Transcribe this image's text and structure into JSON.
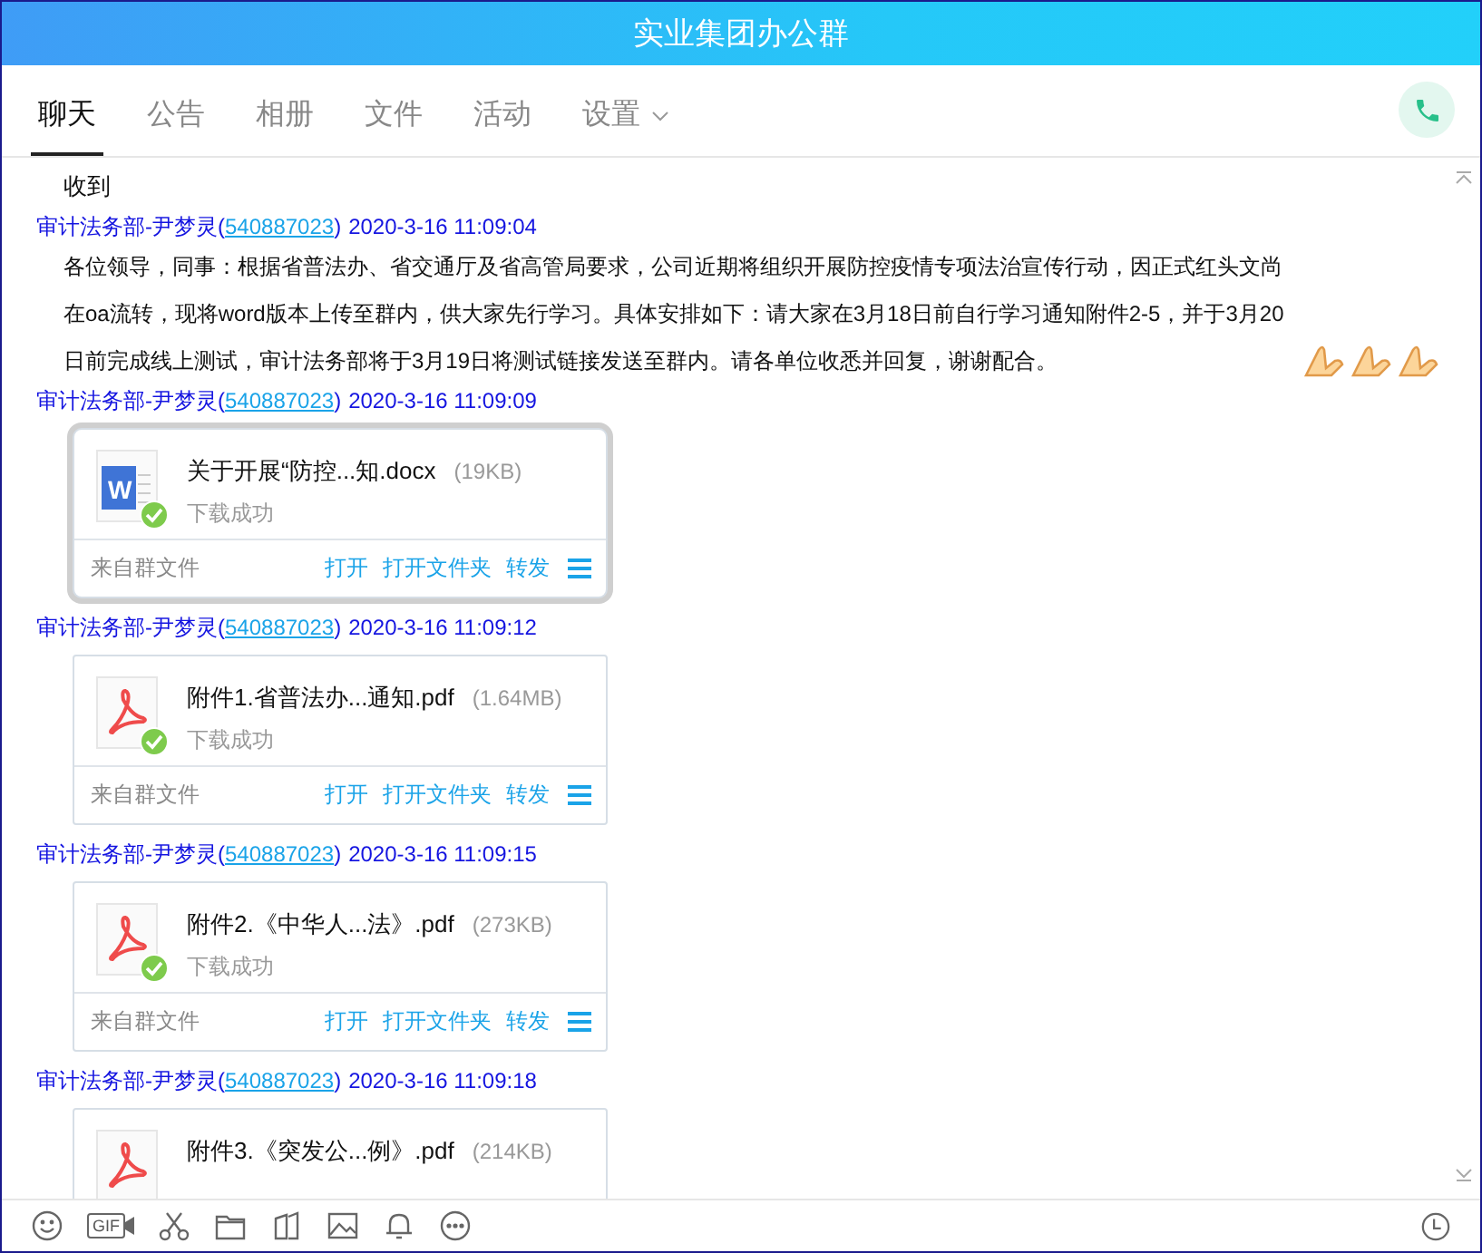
{
  "window": {
    "title": "实业集团办公群"
  },
  "tabs": [
    {
      "label": "聊天",
      "selected": true,
      "dropdown": false
    },
    {
      "label": "公告",
      "selected": false,
      "dropdown": false
    },
    {
      "label": "相册",
      "selected": false,
      "dropdown": false
    },
    {
      "label": "文件",
      "selected": false,
      "dropdown": false
    },
    {
      "label": "活动",
      "selected": false,
      "dropdown": false
    },
    {
      "label": "设置",
      "selected": false,
      "dropdown": true
    }
  ],
  "messages": [
    {
      "kind": "text",
      "body": "收到"
    },
    {
      "kind": "text",
      "sender_prefix": "审计法务部-尹梦灵(",
      "sender_id": "540887023",
      "sender_suffix": ")",
      "time": "2020-3-16 11:09:04",
      "body": "各位领导，同事：根据省普法办、省交通厅及省高管局要求，公司近期将组织开展防控疫情专项法治宣传行动，因正式红头文尚在oa流转，现将word版本上传至群内，供大家先行学习。具体安排如下：请大家在3月18日前自行学习通知附件2-5，并于3月20日前完成线上测试，审计法务部将于3月19日将测试链接发送至群内。请各单位收悉并回复，谢谢配合。",
      "emojis": [
        {
          "kind": "pray"
        },
        {
          "kind": "pray"
        },
        {
          "kind": "pray"
        }
      ]
    },
    {
      "kind": "file",
      "sender_prefix": "审计法务部-尹梦灵(",
      "sender_id": "540887023",
      "sender_suffix": ")",
      "time": "2020-3-16 11:09:09",
      "file": {
        "kind": "word",
        "icon_letter": "W",
        "name": "关于开展“防控...知.docx",
        "size": "(19KB)",
        "status": "下载成功",
        "selected": true,
        "source": "来自群文件",
        "actions": [
          "打开",
          "打开文件夹",
          "转发"
        ]
      }
    },
    {
      "kind": "file",
      "sender_prefix": "审计法务部-尹梦灵(",
      "sender_id": "540887023",
      "sender_suffix": ")",
      "time": "2020-3-16 11:09:12",
      "file": {
        "kind": "pdf",
        "name": "附件1.省普法办...通知.pdf",
        "size": "(1.64MB)",
        "status": "下载成功",
        "selected": false,
        "source": "来自群文件",
        "actions": [
          "打开",
          "打开文件夹",
          "转发"
        ]
      }
    },
    {
      "kind": "file",
      "sender_prefix": "审计法务部-尹梦灵(",
      "sender_id": "540887023",
      "sender_suffix": ")",
      "time": "2020-3-16 11:09:15",
      "file": {
        "kind": "pdf",
        "name": "附件2.《中华人...法》.pdf",
        "size": "(273KB)",
        "status": "下载成功",
        "selected": false,
        "source": "来自群文件",
        "actions": [
          "打开",
          "打开文件夹",
          "转发"
        ]
      }
    },
    {
      "kind": "file",
      "sender_prefix": "审计法务部-尹梦灵(",
      "sender_id": "540887023",
      "sender_suffix": ")",
      "time": "2020-3-16 11:09:18",
      "file": {
        "kind": "pdf",
        "name": "附件3.《突发公...例》.pdf",
        "size": "(214KB)",
        "selected": false
      }
    }
  ],
  "toolbar": [
    {
      "kind": "emoji"
    },
    {
      "kind": "gif",
      "label": "GIF"
    },
    {
      "kind": "scissors"
    },
    {
      "kind": "folder"
    },
    {
      "kind": "shapes"
    },
    {
      "kind": "image"
    },
    {
      "kind": "bell"
    },
    {
      "kind": "more"
    }
  ]
}
